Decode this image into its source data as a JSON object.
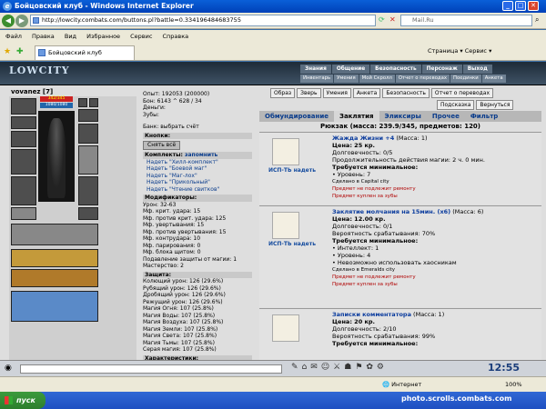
{
  "window": {
    "title": "Бойцовский клуб - Windows Internet Explorer"
  },
  "address": {
    "url": "http://lowcity.combats.com/buttons.pl?battle=0.334196484683755",
    "search_placeholder": "Mail.Ru"
  },
  "menu": [
    "Файл",
    "Правка",
    "Вид",
    "Избранное",
    "Сервис",
    "Справка"
  ],
  "tab": {
    "label": "Бойцовский клуб",
    "tools": "Страница ▾  Сервис ▾"
  },
  "site": {
    "logo": "LOWCITY",
    "nav": [
      "Знания",
      "Общение",
      "Безопасность",
      "Персонаж",
      "Выход"
    ],
    "subnav": [
      "Инвентарь",
      "Умения",
      "Мой Скролл",
      "Отчет о переводах",
      "Поединки",
      "Анкета"
    ]
  },
  "character": {
    "name": "vovanez [7]",
    "hp": "342/345",
    "mp": "1080/1080",
    "exp": "Опыт: 192053 (200000)",
    "bonus": "Бон: 6143 ^ 628 / 34",
    "money": "Деньги:",
    "teeth": "Зубы:",
    "bank": "Банк: выбрать счёт",
    "buttons_hd": "Кнопки:",
    "remove_all": "Снять всё",
    "sets_hd": "Комплекты:",
    "sets_remember": "запомнить",
    "sets": [
      "Надеть \"Хилл-комплект\"",
      "Надеть \"Боевой маг\"",
      "Надеть \"Маг-лох\"",
      "Надеть \"Прикольный\"",
      "Надеть \"Чтение свитков\""
    ],
    "mods_hd": "Модификаторы:",
    "mods": [
      "Урон: 32-63",
      "Мф. крит. удара: 15",
      "Мф. против крит. удара: 125",
      "Мф. увертывания: 15",
      "Мф. против увертывания: 15",
      "Мф. контрудара: 10",
      "Мф. парирования: 0",
      "Мф. блока щитом: 0",
      "Подавление защиты от магии: 1",
      "Мастерство: 2"
    ],
    "defense_hd": "Защита:",
    "defense": [
      "Колющий урон: 126 (29.6%)",
      "Рубящий урон: 126 (29.6%)",
      "Дробящий урон: 126 (29.6%)",
      "Режущий урон: 126 (29.6%)",
      "Магия Огня: 107 (25.8%)",
      "Магия Воды: 107 (25.8%)",
      "Магия Воздуха: 107 (25.8%)",
      "Магия Земли: 107 (25.8%)",
      "Магия Света: 107 (25.8%)",
      "Магия Тьмы: 107 (25.8%)",
      "Серая магия: 107 (25.8%)"
    ],
    "chars_hd": "Характеристики:"
  },
  "right": {
    "topbtns": [
      "Образ",
      "Зверь",
      "Умения",
      "Анкета",
      "Безопасность",
      "Отчет о переводах"
    ],
    "midbtns": [
      "Подсказка",
      "Вернуться"
    ],
    "cats": [
      "Обмундирование",
      "Заклятия",
      "Эликсиры",
      "Прочее",
      "Фильтр"
    ],
    "bag_title": "Рюкзак (масса: 239.9/345, предметов: 120)",
    "items": [
      {
        "title": "Жажда Жизни +4",
        "mass": "(Масса: 1)",
        "lines": [
          "Цена: 25 кр.",
          "Долговечность: 0/5",
          "Продолжительность действия магии: 2 ч. 0 мин.",
          "Требуется минимальное:",
          "• Уровень: 7",
          "Сделано в Capital city"
        ],
        "warns": [
          "Предмет не подлежит ремонту",
          "Предмет куплен за зубы"
        ],
        "action": "ИСП-ТЬ надеть"
      },
      {
        "title": "Заклятие молчания на 15мин. (x6)",
        "mass": "(Масса: 6)",
        "lines": [
          "Цена: 12.00 кр.",
          "Долговечность: 0/1",
          "Вероятность срабатывания: 70%",
          "Требуется минимальное:",
          "• Интеллект: 1",
          "• Уровень: 4",
          "• Невозможно использовать хаосникам",
          "Сделано в Emeralds city"
        ],
        "warns": [
          "Предмет не подлежит ремонту",
          "Предмет куплен за зубы"
        ],
        "action": "ИСП-ТЬ надеть"
      },
      {
        "title": "Записки комментатора",
        "mass": "(Масса: 1)",
        "lines": [
          "Цена: 20 кр.",
          "Долговечность: 2/10",
          "Вероятность срабатывания: 99%",
          "Требуется минимальное:"
        ],
        "warns": [],
        "action": ""
      }
    ]
  },
  "status": {
    "clock": "12:55",
    "zone": "Интернет",
    "zoom": "100%"
  },
  "taskbar": {
    "start": "пуск"
  },
  "watermark": "photo.scrolls.combats.com"
}
